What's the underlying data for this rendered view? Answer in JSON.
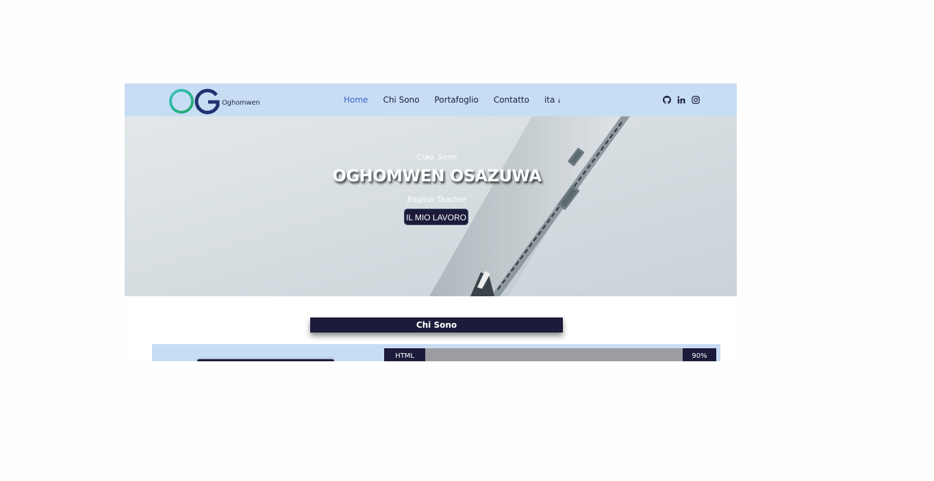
{
  "brand": {
    "logo_text": "Oghomwen",
    "logo_colors": {
      "ring": "#2fb8b0",
      "ring2": "#22a865",
      "letter": "#1f3270"
    }
  },
  "nav": {
    "items": [
      {
        "label": "Home",
        "active": true
      },
      {
        "label": "Chi Sono",
        "active": false
      },
      {
        "label": "Portafoglio",
        "active": false
      },
      {
        "label": "Contatto",
        "active": false
      }
    ],
    "language": "ita",
    "language_caret": "↓"
  },
  "socials": [
    "github-icon",
    "linkedin-icon",
    "instagram-icon"
  ],
  "hero": {
    "greeting": "Ciao, Sono",
    "name": "OGHOMWEN OSAZUWA",
    "role": "English Teacher",
    "cta": "IL MIO LAVORO"
  },
  "about": {
    "title": "Chi Sono",
    "skills": [
      {
        "label": "HTML",
        "value_text": "90%",
        "percent": 90
      }
    ]
  },
  "colors": {
    "navbar_bg": "#c7ddf3",
    "accent_dark": "#1c1b3a",
    "active_link": "#3d63c9",
    "skill_track": "#9d9ca0"
  }
}
